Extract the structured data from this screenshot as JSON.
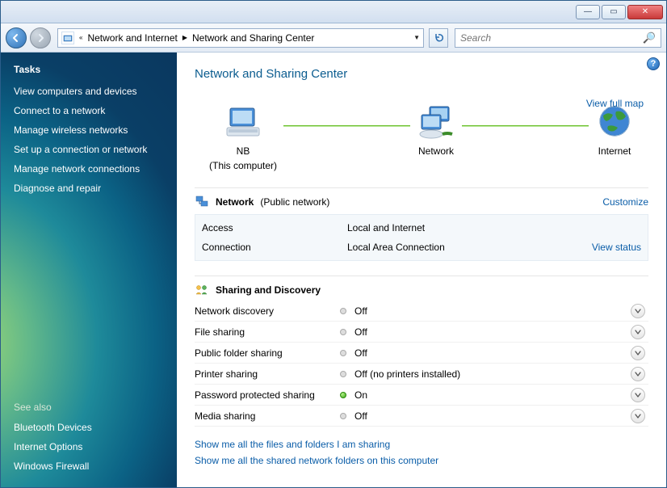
{
  "titlebar": {},
  "breadcrumb": {
    "parent": "Network and Internet",
    "current": "Network and Sharing Center"
  },
  "search": {
    "placeholder": "Search"
  },
  "sidebar": {
    "tasks_heading": "Tasks",
    "tasks": [
      "View computers and devices",
      "Connect to a network",
      "Manage wireless networks",
      "Set up a connection or network",
      "Manage network connections",
      "Diagnose and repair"
    ],
    "seealso_heading": "See also",
    "seealso": [
      "Bluetooth Devices",
      "Internet Options",
      "Windows Firewall"
    ]
  },
  "page": {
    "title": "Network and Sharing Center",
    "view_full_map": "View full map",
    "map": {
      "this_pc": "NB",
      "this_pc_sub": "(This computer)",
      "network": "Network",
      "internet": "Internet"
    },
    "network_section": {
      "icon": "network-icon",
      "name": "Network",
      "type": "(Public network)",
      "customize": "Customize",
      "rows": [
        {
          "key": "Access",
          "value": "Local and Internet"
        },
        {
          "key": "Connection",
          "value": "Local Area Connection",
          "action": "View status"
        }
      ]
    },
    "sharing": {
      "heading": "Sharing and Discovery",
      "items": [
        {
          "key": "Network discovery",
          "value": "Off",
          "on": false
        },
        {
          "key": "File sharing",
          "value": "Off",
          "on": false
        },
        {
          "key": "Public folder sharing",
          "value": "Off",
          "on": false
        },
        {
          "key": "Printer sharing",
          "value": "Off (no printers installed)",
          "on": false
        },
        {
          "key": "Password protected sharing",
          "value": "On",
          "on": true
        },
        {
          "key": "Media sharing",
          "value": "Off",
          "on": false
        }
      ]
    },
    "bottom_links": [
      "Show me all the files and folders I am sharing",
      "Show me all the shared network folders on this computer"
    ]
  }
}
